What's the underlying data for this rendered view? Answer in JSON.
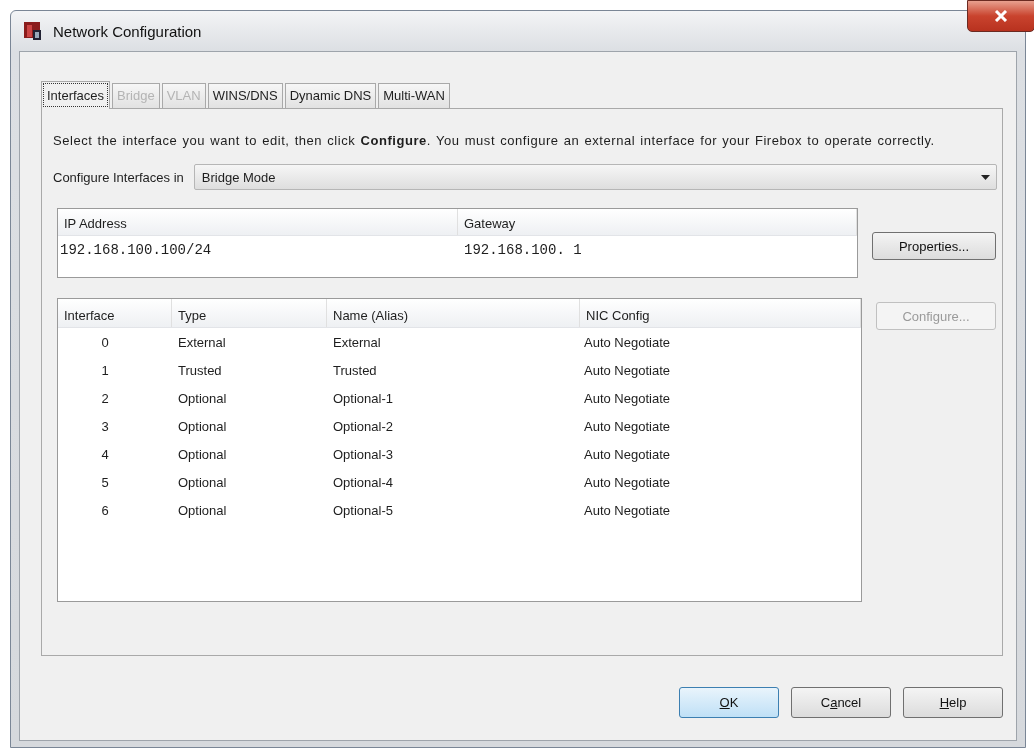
{
  "window": {
    "title": "Network Configuration"
  },
  "tabs": [
    {
      "label": "Interfaces",
      "selected": true,
      "disabled": false
    },
    {
      "label": "Bridge",
      "selected": false,
      "disabled": true
    },
    {
      "label": "VLAN",
      "selected": false,
      "disabled": true
    },
    {
      "label": "WINS/DNS",
      "selected": false,
      "disabled": false
    },
    {
      "label": "Dynamic DNS",
      "selected": false,
      "disabled": false
    },
    {
      "label": "Multi-WAN",
      "selected": false,
      "disabled": false
    }
  ],
  "description": "Select the interface you want to edit, then click **Configure**. You must configure an external interface for your Firebox to operate correctly.",
  "mode": {
    "label": "Configure Interfaces in",
    "value": "Bridge Mode"
  },
  "address_table": {
    "columns": [
      "IP Address",
      "Gateway"
    ],
    "rows": [
      [
        "192.168.100.100/24",
        "192.168.100. 1"
      ]
    ]
  },
  "properties_button": {
    "label": "Properties...",
    "disabled": false
  },
  "interface_table": {
    "columns": [
      "Interface",
      "Type",
      "Name (Alias)",
      "NIC Config"
    ],
    "rows": [
      [
        "0",
        "External",
        "External",
        "Auto Negotiate"
      ],
      [
        "1",
        "Trusted",
        "Trusted",
        "Auto Negotiate"
      ],
      [
        "2",
        "Optional",
        "Optional-1",
        "Auto Negotiate"
      ],
      [
        "3",
        "Optional",
        "Optional-2",
        "Auto Negotiate"
      ],
      [
        "4",
        "Optional",
        "Optional-3",
        "Auto Negotiate"
      ],
      [
        "5",
        "Optional",
        "Optional-4",
        "Auto Negotiate"
      ],
      [
        "6",
        "Optional",
        "Optional-5",
        "Auto Negotiate"
      ]
    ]
  },
  "configure_button": {
    "label": "Configure...",
    "disabled": true
  },
  "buttons": [
    {
      "key": "O",
      "after": "K",
      "default": true
    },
    {
      "before": "C",
      "key": "a",
      "after": "ncel",
      "default": false
    },
    {
      "key": "H",
      "after": "elp",
      "default": false
    }
  ]
}
